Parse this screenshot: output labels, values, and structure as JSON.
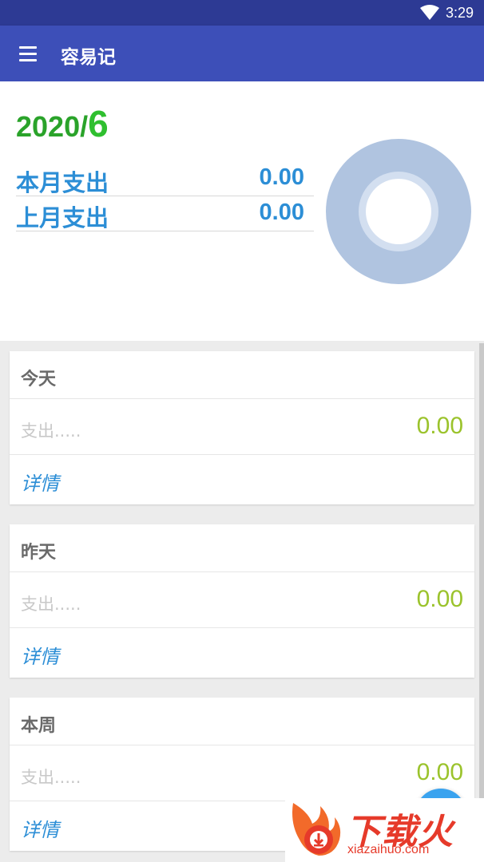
{
  "status_bar": {
    "time": "3:29",
    "wifi_icon": "wifi-icon"
  },
  "app_bar": {
    "menu_icon": "menu-icon",
    "title": "容易记"
  },
  "summary": {
    "year": "2020/",
    "month": "6",
    "this_month_label": "本月支出",
    "this_month_value": "0.00",
    "last_month_label": "上月支出",
    "last_month_value": "0.00",
    "donut_colors": {
      "outer": "#b0c4e0",
      "ring": "#d3dff0",
      "center": "#ffffff"
    }
  },
  "cards": [
    {
      "title": "今天",
      "hint": "支出.....",
      "amount": "0.00",
      "link": "详情"
    },
    {
      "title": "昨天",
      "hint": "支出.....",
      "amount": "0.00",
      "link": "详情"
    },
    {
      "title": "本周",
      "hint": "支出.....",
      "amount": "0.00",
      "link": "详情"
    }
  ],
  "fab": {
    "icon": "add-icon"
  },
  "watermark": {
    "logo_icon": "flame-download-icon",
    "title": "下载火",
    "url": "xiazaihuo.com"
  },
  "colors": {
    "status_bar": "#2d3a94",
    "app_bar": "#3d4fb8",
    "green": "#2aa32a",
    "blue": "#2c8ed6",
    "amount_green": "#9bc32c",
    "fab": "#3aa3ef",
    "watermark_red": "#e63a2a"
  }
}
